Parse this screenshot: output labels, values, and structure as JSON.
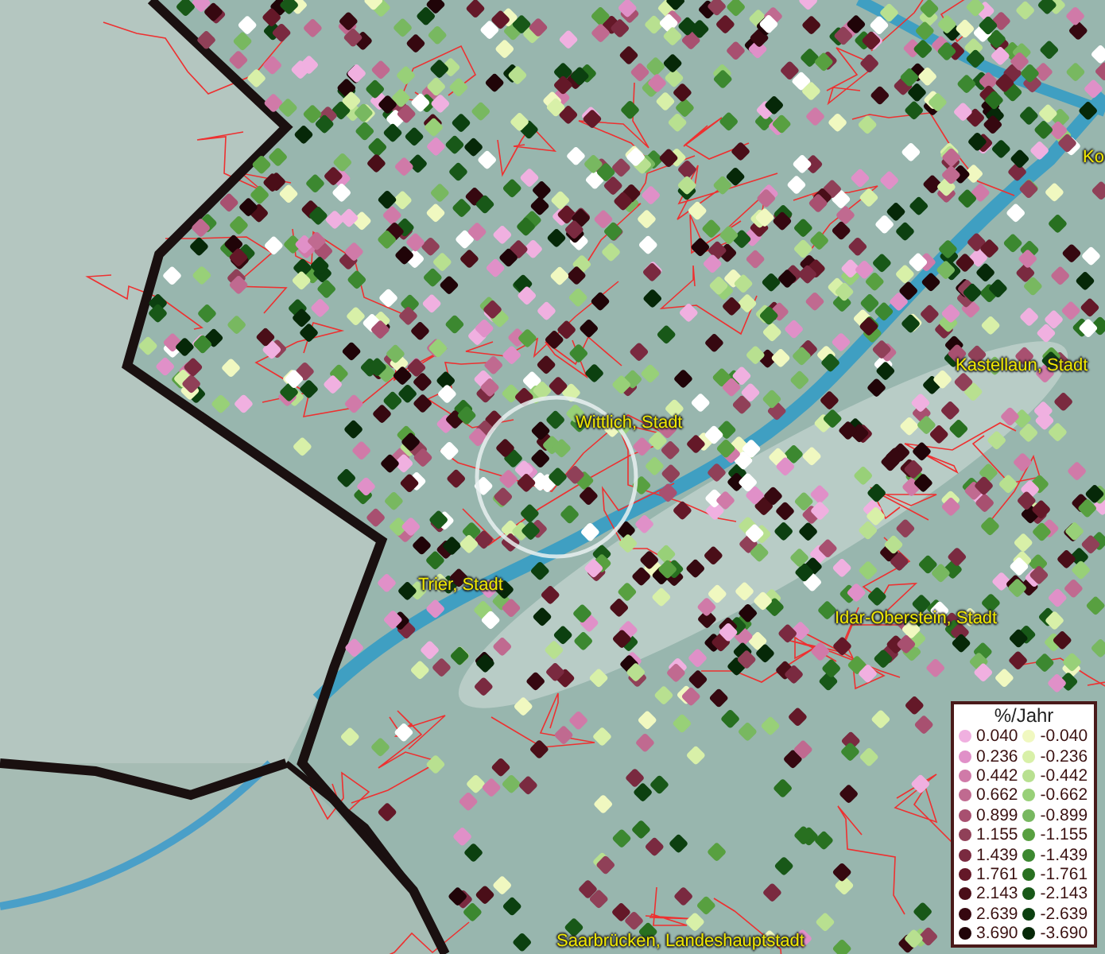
{
  "map": {
    "place_labels": [
      {
        "text": "Ko"
      },
      {
        "text": "Kastellaun, Stadt"
      },
      {
        "text": "Wittlich, Stadt"
      },
      {
        "text": "Trier, Stadt"
      },
      {
        "text": "Idar-Oberstein, Stadt"
      },
      {
        "text": "Saarbrücken, Landeshauptstadt"
      }
    ]
  },
  "legend": {
    "title": "%/Jahr",
    "positive": [
      {
        "label": "0.040",
        "color": "#f0b0e0"
      },
      {
        "label": "0.236",
        "color": "#e090c8"
      },
      {
        "label": "0.442",
        "color": "#d07aa8"
      },
      {
        "label": "0.662",
        "color": "#c06a90"
      },
      {
        "label": "0.899",
        "color": "#a85070"
      },
      {
        "label": "1.155",
        "color": "#904058"
      },
      {
        "label": "1.439",
        "color": "#7a2a40"
      },
      {
        "label": "1.761",
        "color": "#641828"
      },
      {
        "label": "2.143",
        "color": "#4a0e18"
      },
      {
        "label": "2.639",
        "color": "#360810"
      },
      {
        "label": "3.690",
        "color": "#200408"
      }
    ],
    "negative": [
      {
        "label": "-0.040",
        "color": "#f0f8c0"
      },
      {
        "label": "-0.236",
        "color": "#d8f0a8"
      },
      {
        "label": "-0.442",
        "color": "#b8e090"
      },
      {
        "label": "-0.662",
        "color": "#98d078"
      },
      {
        "label": "-0.899",
        "color": "#78b860"
      },
      {
        "label": "-1.155",
        "color": "#58a040"
      },
      {
        "label": "-1.439",
        "color": "#3c8830"
      },
      {
        "label": "-1.761",
        "color": "#287020"
      },
      {
        "label": "-2.143",
        "color": "#185818"
      },
      {
        "label": "-2.639",
        "color": "#0c4010"
      },
      {
        "label": "-3.690",
        "color": "#062808"
      }
    ]
  }
}
